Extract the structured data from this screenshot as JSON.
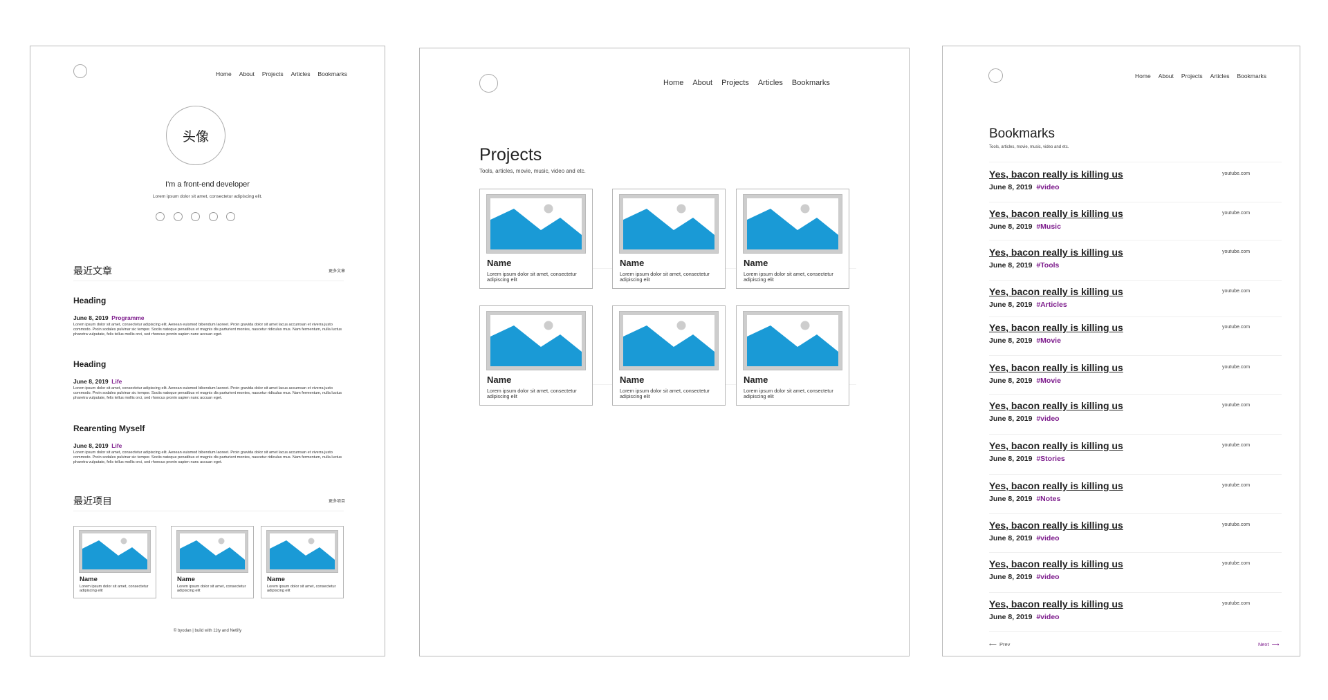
{
  "colors": {
    "tag": "#7d1c8c",
    "image_sky": "#1a9ad6",
    "image_frame": "#cdcdcd"
  },
  "home": {
    "nav": [
      "Home",
      "About",
      "Projects",
      "Articles",
      "Bookmarks"
    ],
    "avatar_text": "头像",
    "tagline": "I'm a front-end developer",
    "subline": "Lorem ipsum dolor sit amet, consectetur adipiscing elit.",
    "recent_articles_title": "最近文章",
    "more_articles": "更多文章",
    "articles": [
      {
        "heading": "Heading",
        "date": "June 8, 2019",
        "tag": "Programme",
        "excerpt": "Lorem ipsum dolor sit amet, consectetur adipiscing elit. Aenean euismod bibendum laoreet. Proin gravida dolor sit amet lacus accumsan et viverra justo commodo. Proin sodales pulvinar sic tempor. Sociis natoque penatibus et magnis dis parturient montes, nascetur ridiculus mus. Nam fermentum, nulla luctus pharetra vulputate, felis tellus mollis orci, sed rhoncus pronin sapien nunc accuan eget."
      },
      {
        "heading": "Heading",
        "date": "June 8, 2019",
        "tag": "Life",
        "excerpt": "Lorem ipsum dolor sit amet, consectetur adipiscing elit. Aenean euismod bibendum laoreet. Proin gravida dolor sit amet lacus accumsan et viverra justo commodo. Proin sodales pulvinar sic tempor. Sociis natoque penatibus et magnis dis parturient montes, nascetur ridiculus mus. Nam fermentum, nulla luctus pharetra vulputate, felis tellus mollis orci, sed rhoncus pronin sapien nunc accuan eget."
      },
      {
        "heading": "Rearenting Myself",
        "date": "June 8, 2019",
        "tag": "Life",
        "excerpt": "Lorem ipsum dolor sit amet, consectetur adipiscing elit. Aenean euismod bibendum laoreet. Proin gravida dolor sit amet lacus accumsan et viverra justo commodo. Proin sodales pulvinar sic tempor. Sociis natoque penatibus et magnis dis parturient montes, nascetur ridiculus mus. Nam fermentum, nulla luctus pharetra vulputate, felis tellus mollis orci, sed rhoncus pronin sapien nunc accuan eget."
      }
    ],
    "recent_projects_title": "最近项目",
    "more_projects": "更多项目",
    "projects": [
      {
        "name": "Name",
        "desc": "Lorem ipsum dolor sit amet, consectetur adipiscing elit"
      },
      {
        "name": "Name",
        "desc": "Lorem ipsum dolor sit amet, consectetur adipiscing elit"
      },
      {
        "name": "Name",
        "desc": "Lorem ipsum dolor sit amet, consectetur adipiscing elit"
      }
    ],
    "footer": "© byodan | build with 11ty and Netlify"
  },
  "projects_page": {
    "nav": [
      "Home",
      "About",
      "Projects",
      "Articles",
      "Bookmarks"
    ],
    "title": "Projects",
    "subtitle": "Tools, articles, movie, music, video and etc.",
    "items": [
      {
        "name": "Name",
        "desc": "Lorem ipsum dolor sit amet, consectetur adipiscing elit"
      },
      {
        "name": "Name",
        "desc": "Lorem ipsum dolor sit amet, consectetur adipiscing elit"
      },
      {
        "name": "Name",
        "desc": "Lorem ipsum dolor sit amet, consectetur adipiscing elit"
      },
      {
        "name": "Name",
        "desc": "Lorem ipsum dolor sit amet, consectetur adipiscing elit"
      },
      {
        "name": "Name",
        "desc": "Lorem ipsum dolor sit amet, consectetur adipiscing elit"
      },
      {
        "name": "Name",
        "desc": "Lorem ipsum dolor sit amet, consectetur adipiscing elit"
      }
    ]
  },
  "bookmarks_page": {
    "nav": [
      "Home",
      "About",
      "Projects",
      "Articles",
      "Bookmarks"
    ],
    "title": "Bookmarks",
    "subtitle": "Tools, articles, movie, music, video and etc.",
    "items": [
      {
        "title": "Yes, bacon really is killing us",
        "date": "June 8, 2019",
        "tag": "#video",
        "source": "youtube.com"
      },
      {
        "title": "Yes, bacon really is killing us",
        "date": "June 8, 2019",
        "tag": "#Music",
        "source": "youtube.com"
      },
      {
        "title": "Yes, bacon really is killing us",
        "date": "June 8, 2019",
        "tag": "#Tools",
        "source": "youtube.com"
      },
      {
        "title": "Yes, bacon really is killing us",
        "date": "June 8, 2019",
        "tag": "#Articles",
        "source": "youtube.com"
      },
      {
        "title": "Yes, bacon really is killing us",
        "date": "June 8, 2019",
        "tag": "#Movie",
        "source": "youtube.com"
      },
      {
        "title": "Yes, bacon really is killing us",
        "date": "June 8, 2019",
        "tag": "#Movie",
        "source": "youtube.com"
      },
      {
        "title": "Yes, bacon really is killing us",
        "date": "June 8, 2019",
        "tag": "#video",
        "source": "youtube.com"
      },
      {
        "title": "Yes, bacon really is killing us",
        "date": "June 8, 2019",
        "tag": "#Stories",
        "source": "youtube.com"
      },
      {
        "title": "Yes, bacon really is killing us",
        "date": "June 8, 2019",
        "tag": "#Notes",
        "source": "youtube.com"
      },
      {
        "title": "Yes, bacon really is killing us",
        "date": "June 8, 2019",
        "tag": "#video",
        "source": "youtube.com"
      },
      {
        "title": "Yes, bacon really is killing us",
        "date": "June 8, 2019",
        "tag": "#video",
        "source": "youtube.com"
      },
      {
        "title": "Yes, bacon really is killing us",
        "date": "June 8, 2019",
        "tag": "#video",
        "source": "youtube.com"
      }
    ],
    "prev": "Prev",
    "next": "Next"
  }
}
